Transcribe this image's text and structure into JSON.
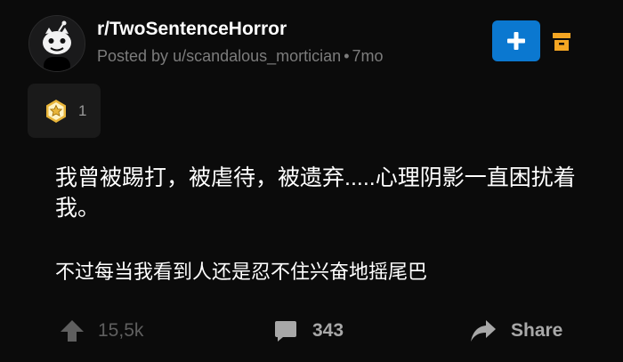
{
  "post": {
    "subreddit": "r/TwoSentenceHorror",
    "posted_by_prefix": "Posted by",
    "author": "u/scandalous_mortician",
    "separator": "•",
    "age": "7mo",
    "award_count": "1",
    "body": {
      "line1": "我曾被踢打，被虐待，被遗弃.....心理阴影一直困扰着我。",
      "line2": "不过每当我看到人还是忍不住兴奋地摇尾巴"
    }
  },
  "footer": {
    "upvotes": "15,5k",
    "comments": "343",
    "share_label": "Share"
  },
  "colors": {
    "background": "#0b0b0b",
    "accent_blue": "#0b78d0",
    "save_orange": "#f5a623",
    "award_gold": "#e8b53a"
  },
  "icons": {
    "join": "plus-icon",
    "save": "archive-box-icon",
    "award": "star-award-icon",
    "upvote": "arrow-up-icon",
    "comments": "comment-bubble-icon",
    "share": "share-arrow-icon"
  }
}
